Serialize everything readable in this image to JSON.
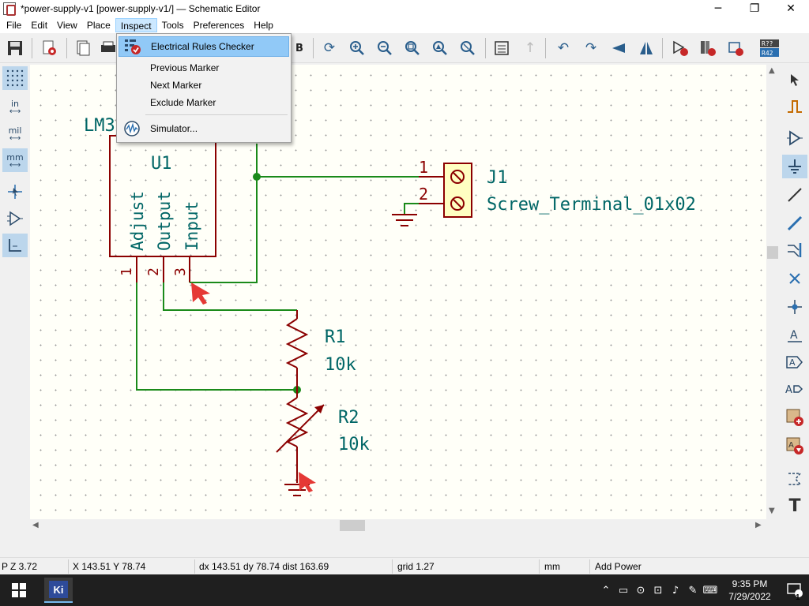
{
  "window": {
    "title": "*power-supply-v1 [power-supply-v1/] — Schematic Editor",
    "minimize": "─",
    "maximize": "❐",
    "close": "✕"
  },
  "menubar": [
    {
      "label": "File"
    },
    {
      "label": "Edit"
    },
    {
      "label": "View"
    },
    {
      "label": "Place"
    },
    {
      "label": "Inspect"
    },
    {
      "label": "Tools"
    },
    {
      "label": "Preferences"
    },
    {
      "label": "Help"
    }
  ],
  "inspect_menu": {
    "items": [
      {
        "label": "Electrical Rules Checker",
        "icon": "erc-icon",
        "highlighted": true
      },
      {
        "label": "Previous Marker"
      },
      {
        "label": "Next Marker"
      },
      {
        "label": "Exclude Marker"
      },
      {
        "label": "Simulator...",
        "icon": "simulator-icon"
      }
    ]
  },
  "left_toolbar": {
    "grid": "grid-icon",
    "inch": "in",
    "mil": "mil",
    "mm": "mm",
    "cursor": "cursor-icon",
    "hidden_pins": "hidden-pins-icon",
    "line_mode": "line-mode-icon"
  },
  "right_toolbar": {
    "sheet_label": "R?? / R42",
    "text_tool": "T"
  },
  "schematic": {
    "u1_value": "LM3",
    "u1_ref": "U1",
    "pin_adjust": "Adjust",
    "pin_output": "Output",
    "pin_input": "Input",
    "pin1": "1",
    "pin2": "2",
    "pin3": "3",
    "j1_ref": "J1",
    "j1_value": "Screw_Terminal_01x02",
    "j1_pin1": "1",
    "j1_pin2": "2",
    "r1_ref": "R1",
    "r1_value": "10k",
    "r2_ref": "R2",
    "r2_value": "10k",
    "colors": {
      "wire": "#1a8a1a",
      "component": "#8b0000",
      "text": "#006666",
      "body_fill": "#ffffc2",
      "marker": "#e53935"
    }
  },
  "statusbar": {
    "zoom": "Z 3.72",
    "coords": "X 143.51  Y 78.74",
    "delta": "dx 143.51  dy 78.74  dist 163.69",
    "grid": "grid 1.27",
    "units": "mm",
    "mode": "Add Power",
    "left_mark": "P"
  },
  "taskbar": {
    "app": "Ki",
    "time": "9:35 PM",
    "date": "7/29/2022",
    "notifications": "1"
  }
}
